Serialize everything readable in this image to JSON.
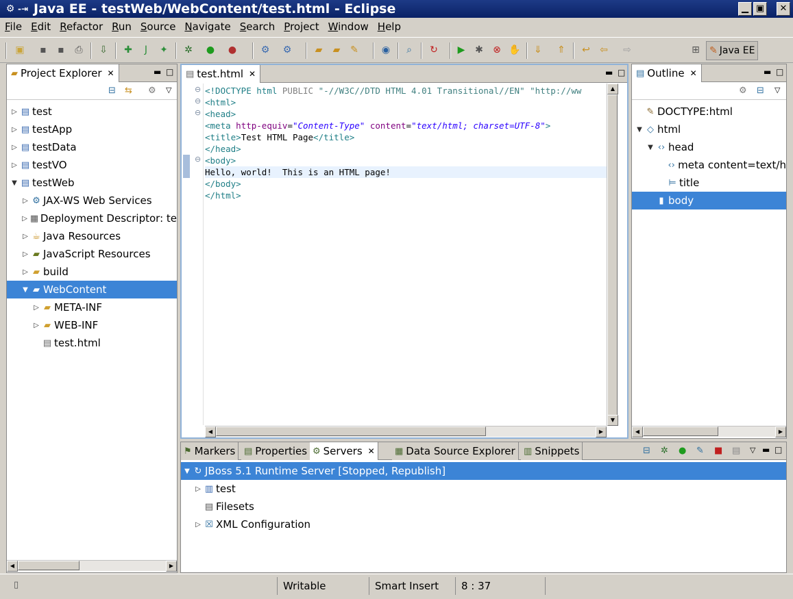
{
  "window": {
    "title": "Java EE - testWeb/WebContent/test.html - Eclipse"
  },
  "menu": [
    "File",
    "Edit",
    "Refactor",
    "Run",
    "Source",
    "Navigate",
    "Search",
    "Project",
    "Window",
    "Help"
  ],
  "perspective": {
    "label": "Java EE"
  },
  "project_explorer": {
    "tab": "Project Explorer",
    "items": [
      {
        "label": "test",
        "icon": "project-icon",
        "expanded": false,
        "depth": 0
      },
      {
        "label": "testApp",
        "icon": "project-icon",
        "expanded": false,
        "depth": 0
      },
      {
        "label": "testData",
        "icon": "project-icon",
        "expanded": false,
        "depth": 0
      },
      {
        "label": "testVO",
        "icon": "project-icon",
        "expanded": false,
        "depth": 0
      },
      {
        "label": "testWeb",
        "icon": "project-icon",
        "expanded": true,
        "depth": 0
      },
      {
        "label": "JAX-WS Web Services",
        "icon": "web-services-icon",
        "expanded": false,
        "depth": 1
      },
      {
        "label": "Deployment Descriptor: te",
        "icon": "descriptor-icon",
        "expanded": false,
        "depth": 1
      },
      {
        "label": "Java Resources",
        "icon": "java-resources-icon",
        "expanded": false,
        "depth": 1
      },
      {
        "label": "JavaScript Resources",
        "icon": "javascript-resources-icon",
        "expanded": false,
        "depth": 1
      },
      {
        "label": "build",
        "icon": "folder-icon",
        "expanded": false,
        "depth": 1
      },
      {
        "label": "WebContent",
        "icon": "folder-icon",
        "expanded": true,
        "depth": 1,
        "selected": true
      },
      {
        "label": "META-INF",
        "icon": "folder-icon",
        "expanded": false,
        "depth": 2
      },
      {
        "label": "WEB-INF",
        "icon": "folder-icon",
        "expanded": false,
        "depth": 2
      },
      {
        "label": "test.html",
        "icon": "html-file-icon",
        "leaf": true,
        "depth": 2
      }
    ]
  },
  "editor": {
    "tab": "test.html",
    "lines": [
      {
        "fold": "−",
        "html": "<span class=\"c-doc\">&lt;!DOCTYPE html</span> <span class=\"c-attr\" style=\"color:#7f7f7f\">PUBLIC</span> <span class=\"c-dq\">\"-//W3C//DTD HTML 4.01 Transitional//EN\"</span> <span class=\"c-dq\">\"http://ww</span>"
      },
      {
        "fold": "−",
        "html": "<span class=\"c-tag\">&lt;html&gt;</span>"
      },
      {
        "fold": "−",
        "html": "<span class=\"c-tag\">&lt;head&gt;</span>"
      },
      {
        "fold": "",
        "html": "<span class=\"c-tag\">&lt;meta</span> <span class=\"c-attr\">http-equiv</span>=<span class=\"c-val\">\"Content-Type\"</span> <span class=\"c-attr\">content</span>=<span class=\"c-val\">\"text/html; charset=UTF-8\"</span><span class=\"c-tag\">&gt;</span>"
      },
      {
        "fold": "",
        "html": "<span class=\"c-tag\">&lt;title&gt;</span>Test HTML Page<span class=\"c-tag\">&lt;/title&gt;</span>"
      },
      {
        "fold": "",
        "html": "<span class=\"c-tag\">&lt;/head&gt;</span>"
      },
      {
        "fold": "−",
        "html": "<span class=\"c-tag\">&lt;body&gt;</span>"
      },
      {
        "fold": "",
        "html": "Hello, world!  This is an HTML page!",
        "current": true
      },
      {
        "fold": "",
        "html": "<span class=\"c-tag\">&lt;/body&gt;</span>"
      },
      {
        "fold": "",
        "html": "<span class=\"c-tag\">&lt;/html&gt;</span>"
      }
    ]
  },
  "outline": {
    "tab": "Outline",
    "items": [
      {
        "label": "DOCTYPE:html",
        "icon": "doctype-icon",
        "depth": 0,
        "twist": ""
      },
      {
        "label": "html",
        "icon": "element-icon",
        "depth": 0,
        "twist": "open"
      },
      {
        "label": "head",
        "icon": "tag-icon",
        "depth": 1,
        "twist": "open"
      },
      {
        "label": "meta content=text/h",
        "icon": "tag-icon",
        "depth": 2,
        "twist": ""
      },
      {
        "label": "title",
        "icon": "title-icon",
        "depth": 2,
        "twist": ""
      },
      {
        "label": "body",
        "icon": "body-icon",
        "depth": 1,
        "twist": "",
        "selected": true
      }
    ]
  },
  "bottom_tabs": [
    {
      "label": "Markers",
      "icon": "markers-icon",
      "active": false
    },
    {
      "label": "Properties",
      "icon": "properties-icon",
      "active": false
    },
    {
      "label": "Servers",
      "icon": "servers-icon",
      "active": true
    },
    {
      "label": "Data Source Explorer",
      "icon": "data-source-icon",
      "active": false
    },
    {
      "label": "Snippets",
      "icon": "snippets-icon",
      "active": false
    }
  ],
  "servers": {
    "items": [
      {
        "label": "JBoss 5.1 Runtime Server  [Stopped, Republish]",
        "icon": "server-icon",
        "depth": 0,
        "twist": "open",
        "selected": true
      },
      {
        "label": "test",
        "icon": "module-icon",
        "depth": 1,
        "twist": "closed"
      },
      {
        "label": "Filesets",
        "icon": "filesets-icon",
        "depth": 1,
        "twist": ""
      },
      {
        "label": "XML Configuration",
        "icon": "xml-config-icon",
        "depth": 1,
        "twist": "closed"
      }
    ]
  },
  "status": {
    "mode": "Writable",
    "insert": "Smart Insert",
    "position": "8 : 37"
  }
}
